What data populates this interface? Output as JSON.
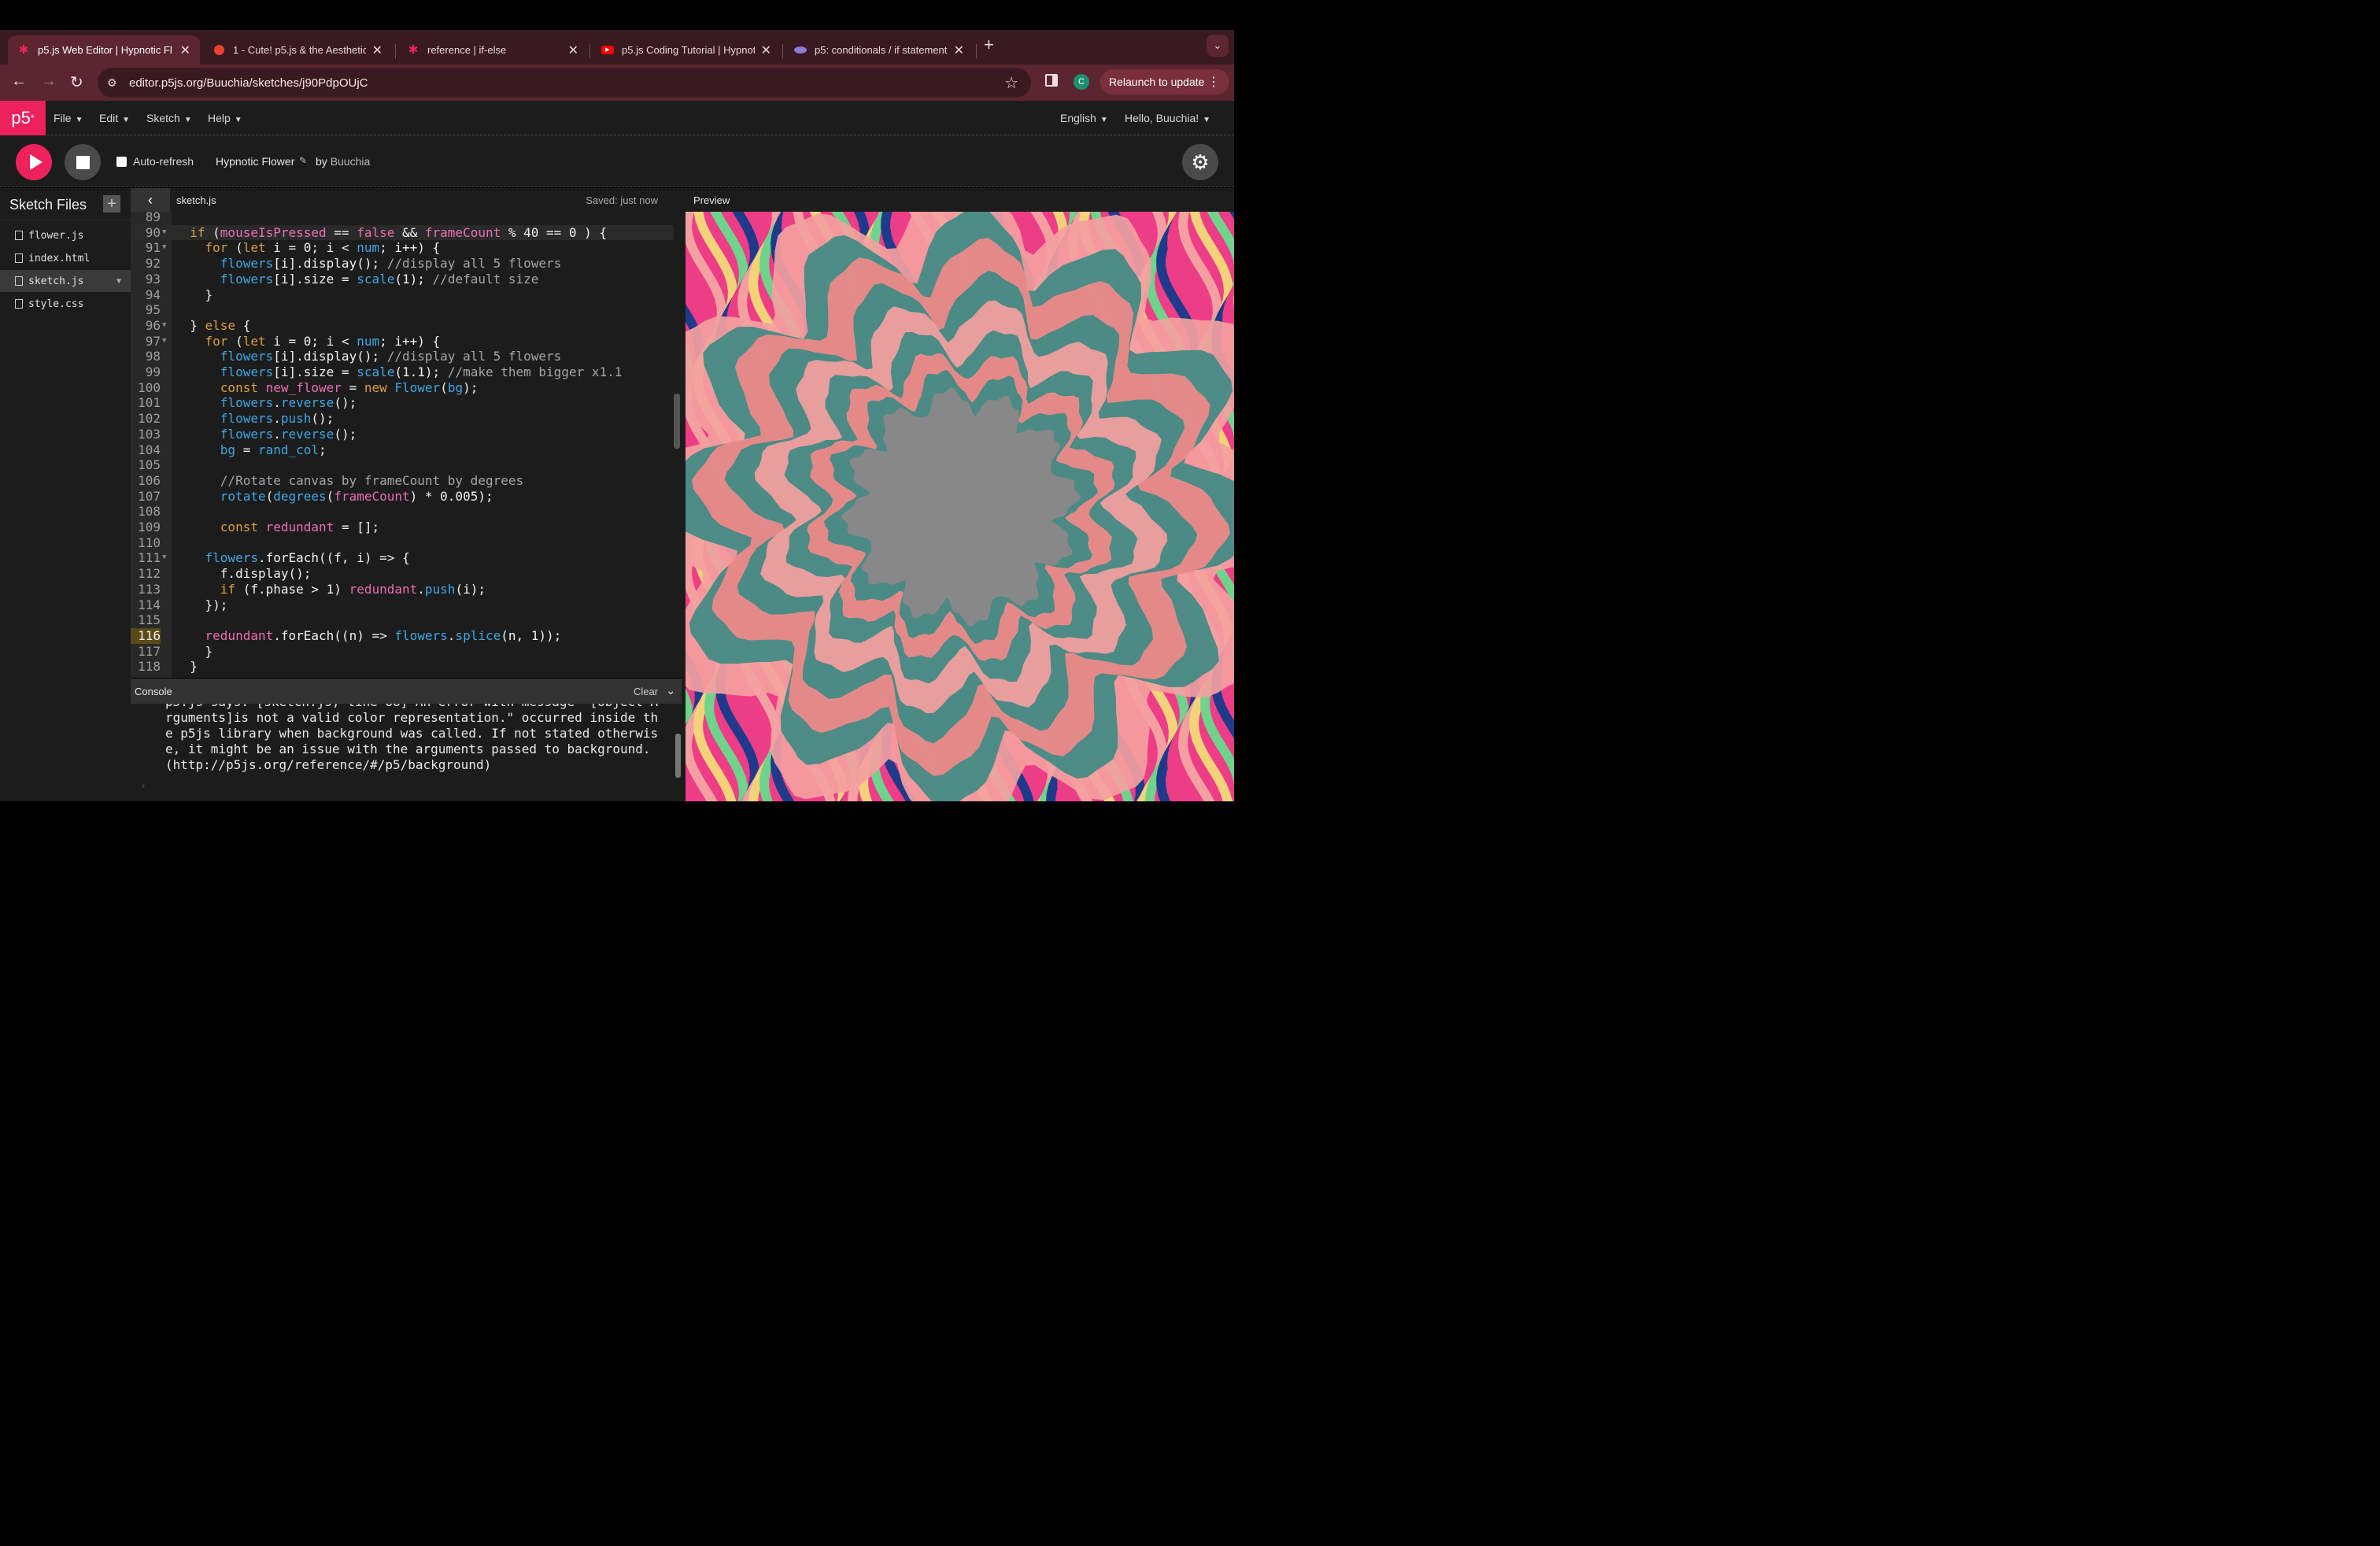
{
  "browser": {
    "tabs": [
      {
        "title": "p5.js Web Editor | Hypnotic Fl",
        "favicon": "p5-star-icon",
        "active": true
      },
      {
        "title": "1 - Cute! p5.js & the Aesthetic",
        "favicon": "red-blob-icon",
        "active": false
      },
      {
        "title": "reference | if-else",
        "favicon": "p5-star-icon",
        "active": false
      },
      {
        "title": "p5.js Coding Tutorial | Hypnot",
        "favicon": "youtube-icon",
        "active": false
      },
      {
        "title": "p5: conditionals / if statement",
        "favicon": "purple-hat-icon",
        "active": false
      }
    ],
    "url": "editor.p5js.org/Buuchia/sketches/j90PdpOUjC",
    "profile_initial": "C",
    "relaunch_label": "Relaunch to update"
  },
  "p5nav": {
    "logo": "p5",
    "logo_sup": "*",
    "menus": [
      "File",
      "Edit",
      "Sketch",
      "Help"
    ],
    "language": "English",
    "greeting": "Hello, Buuchia!"
  },
  "toolbar": {
    "auto_refresh_label": "Auto-refresh",
    "auto_refresh_checked": false,
    "sketch_name": "Hypnotic Flower",
    "by_label": "by",
    "author": "Buuchia"
  },
  "sidebar": {
    "title": "Sketch Files",
    "files": [
      {
        "name": "flower.js",
        "active": false
      },
      {
        "name": "index.html",
        "active": false
      },
      {
        "name": "sketch.js",
        "active": true
      },
      {
        "name": "style.css",
        "active": false
      }
    ]
  },
  "editor": {
    "filename": "sketch.js",
    "saved_status": "Saved: just now",
    "current_line": 90,
    "highlight_line": 116,
    "lines": [
      {
        "n": "89",
        "fold": false,
        "code": ""
      },
      {
        "n": "90",
        "fold": true,
        "code": "  if (mouseIsPressed == false && frameCount % 40 == 0 ) {"
      },
      {
        "n": "91",
        "fold": true,
        "code": "    for (let i = 0; i < num; i++) {"
      },
      {
        "n": "92",
        "fold": false,
        "code": "      flowers[i].display(); //display all 5 flowers"
      },
      {
        "n": "93",
        "fold": false,
        "code": "      flowers[i].size = scale(1); //default size"
      },
      {
        "n": "94",
        "fold": false,
        "code": "    }"
      },
      {
        "n": "95",
        "fold": false,
        "code": ""
      },
      {
        "n": "96",
        "fold": true,
        "code": "  } else {"
      },
      {
        "n": "97",
        "fold": true,
        "code": "    for (let i = 0; i < num; i++) {"
      },
      {
        "n": "98",
        "fold": false,
        "code": "      flowers[i].display(); //display all 5 flowers"
      },
      {
        "n": "99",
        "fold": false,
        "code": "      flowers[i].size = scale(1.1); //make them bigger x1.1"
      },
      {
        "n": "100",
        "fold": false,
        "code": "      const new_flower = new Flower(bg);"
      },
      {
        "n": "101",
        "fold": false,
        "code": "      flowers.reverse();"
      },
      {
        "n": "102",
        "fold": false,
        "code": "      flowers.push();"
      },
      {
        "n": "103",
        "fold": false,
        "code": "      flowers.reverse();"
      },
      {
        "n": "104",
        "fold": false,
        "code": "      bg = rand_col;"
      },
      {
        "n": "105",
        "fold": false,
        "code": ""
      },
      {
        "n": "106",
        "fold": false,
        "code": "      //Rotate canvas by frameCount by degrees"
      },
      {
        "n": "107",
        "fold": false,
        "code": "      rotate(degrees(frameCount) * 0.005);"
      },
      {
        "n": "108",
        "fold": false,
        "code": ""
      },
      {
        "n": "109",
        "fold": false,
        "code": "      const redundant = [];"
      },
      {
        "n": "110",
        "fold": false,
        "code": ""
      },
      {
        "n": "111",
        "fold": true,
        "code": "    flowers.forEach((f, i) => {"
      },
      {
        "n": "112",
        "fold": false,
        "code": "      f.display();"
      },
      {
        "n": "113",
        "fold": false,
        "code": "      if (f.phase > 1) redundant.push(i);"
      },
      {
        "n": "114",
        "fold": false,
        "code": "    });"
      },
      {
        "n": "115",
        "fold": false,
        "code": ""
      },
      {
        "n": "116",
        "fold": false,
        "code": "    redundant.forEach((n) => flowers.splice(n, 1));"
      },
      {
        "n": "117",
        "fold": false,
        "code": "    }"
      },
      {
        "n": "118",
        "fold": false,
        "code": "  }"
      }
    ]
  },
  "console": {
    "title": "Console",
    "clear_label": "Clear",
    "message": "p5.js says: [sketch.js, line 68] An error with message \"[object Arguments]is not a valid color representation.\" occurred inside the p5js library when background was called. If not stated otherwise, it might be an issue with the arguments passed to background. (http://p5js.org/reference/#/p5/background)"
  },
  "preview": {
    "label": "Preview",
    "colors": [
      "#ee3d87",
      "#f4a0a0",
      "#f3d27a",
      "#6fd38b",
      "#1f3a8a",
      "#3f8a84",
      "#888888",
      "#f08a8a"
    ]
  },
  "colors": {
    "p5_pink": "#ed225d",
    "tab_bg": "#3a1a22",
    "address_bg": "#5b2630"
  }
}
